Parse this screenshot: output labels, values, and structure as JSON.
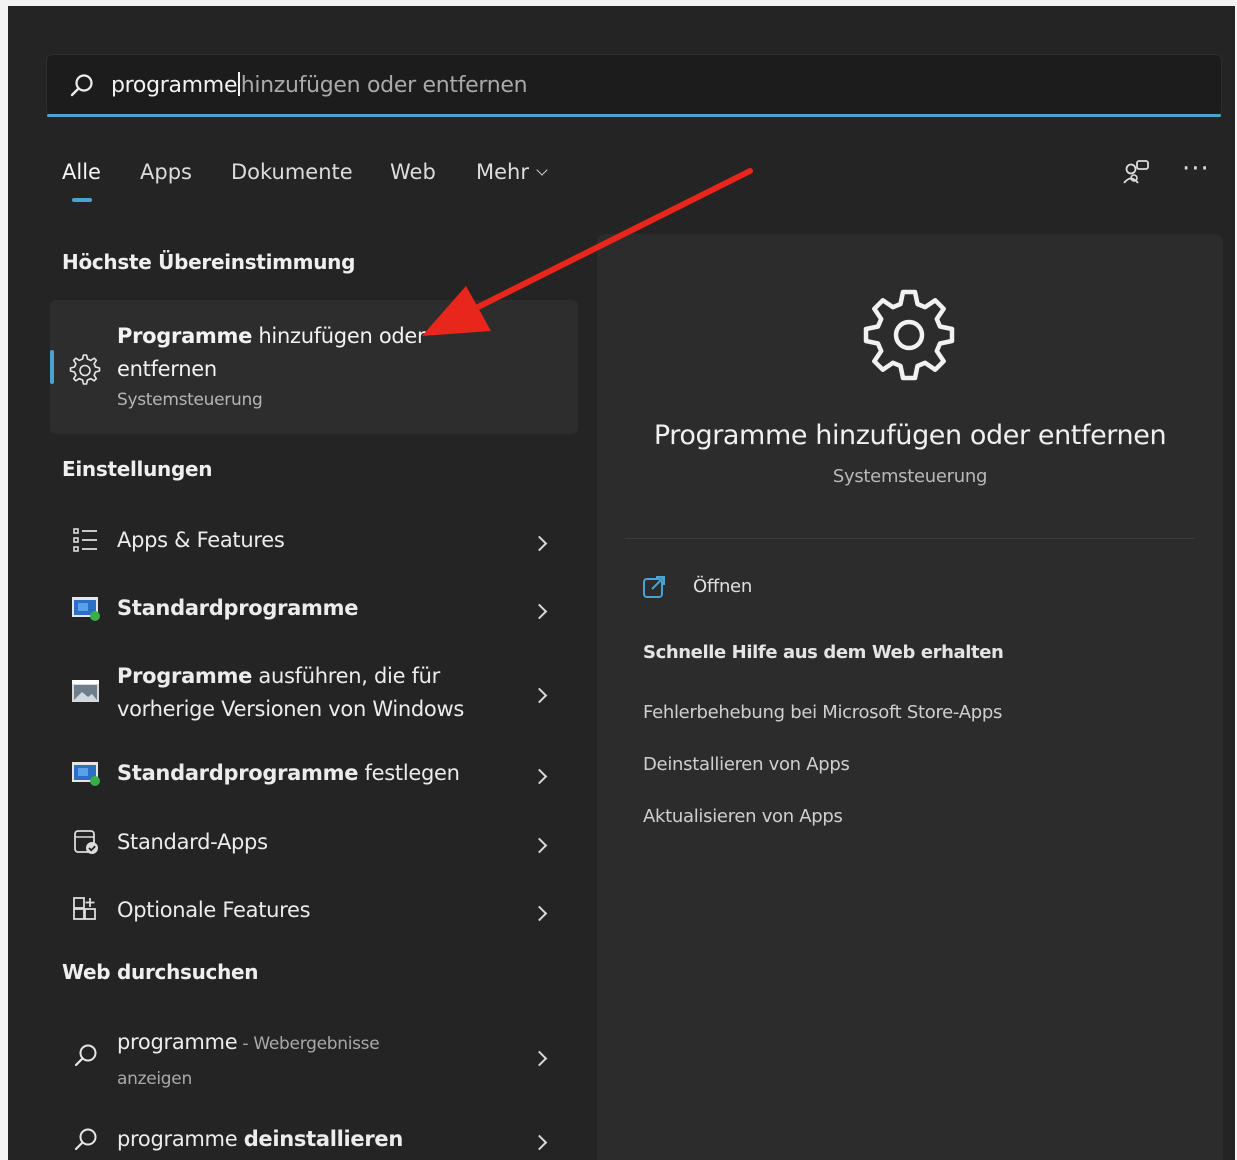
{
  "search": {
    "typed": "programme",
    "suggestion": "hinzufügen oder entfernen"
  },
  "tabs": {
    "all": "Alle",
    "apps": "Apps",
    "documents": "Dokumente",
    "web": "Web",
    "more": "Mehr"
  },
  "toolbar": {
    "more_label": "···"
  },
  "best_match": {
    "heading": "Höchste Übereinstimmung",
    "title_bold": "Programme",
    "title_rest_line1": " hinzufügen oder",
    "title_line2": "entfernen",
    "subtitle": "Systemsteuerung",
    "icon": "gear-icon"
  },
  "settings": {
    "heading": "Einstellungen",
    "items": [
      {
        "label": "Apps & Features",
        "icon": "list-icon"
      },
      {
        "label_bold": "Standardprogramme",
        "icon": "default-programs-icon"
      },
      {
        "label_bold": "Programme",
        "label_rest_line1": " ausführen, die für",
        "label_line2": "vorherige Versionen von Windows",
        "icon": "compat-icon"
      },
      {
        "label_bold": "Standardprogramme",
        "label_rest": " festlegen",
        "icon": "default-programs-icon"
      },
      {
        "label": "Standard-Apps",
        "icon": "standard-apps-icon"
      },
      {
        "label": "Optionale Features",
        "icon": "optional-features-icon"
      }
    ]
  },
  "web_search": {
    "heading": "Web durchsuchen",
    "items": [
      {
        "query": "programme",
        "suffix": " - Webergebnisse",
        "line2": "anzeigen"
      },
      {
        "query": "programme ",
        "query_bold": "deinstallieren"
      }
    ]
  },
  "detail": {
    "title": "Programme hinzufügen oder entfernen",
    "subtitle": "Systemsteuerung",
    "open_label": "Öffnen",
    "web_help_heading": "Schnelle Hilfe aus dem Web erhalten",
    "links": [
      "Fehlerbehebung bei Microsoft Store-Apps",
      "Deinstallieren von Apps",
      "Aktualisieren von Apps"
    ]
  },
  "colors": {
    "accent": "#4aa3d0",
    "arrow": "#e8261c",
    "background": "#242424",
    "panel": "#2c2c2c"
  }
}
